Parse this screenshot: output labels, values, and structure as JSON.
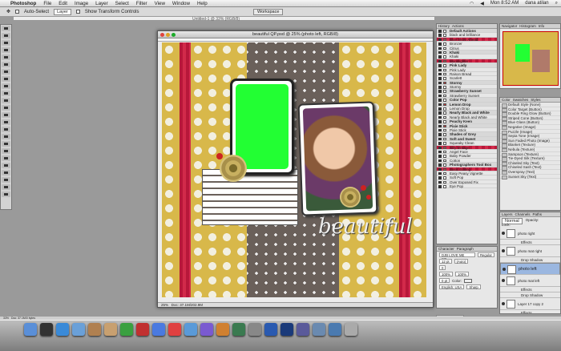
{
  "menubar": {
    "apple": "",
    "app_name": "Photoshop",
    "items": [
      "File",
      "Edit",
      "Image",
      "Layer",
      "Select",
      "Filter",
      "View",
      "Window",
      "Help"
    ],
    "clock": "Mon 8:52 AM",
    "user": "dana atilan"
  },
  "options": {
    "auto_select": "Auto-Select",
    "auto_select_value": "Layer",
    "show_transform": "Show Transform Controls",
    "workspace": "Workspace"
  },
  "background_doc": {
    "title": "Untitled-1 @ 33% (RGB/8)"
  },
  "document": {
    "title": "beautiful QP.psd @ 25% (photo left, RGB/8)",
    "zoom": "25%",
    "doc_size": "Doc: 37.1M/202.9M",
    "script_word": "beautiful"
  },
  "status": {
    "zoom": "33%",
    "doc_size": "Doc: 37.1M/0 bytes"
  },
  "navigator": {
    "tabs": [
      "Navigator",
      "Histogram",
      "Info"
    ]
  },
  "history_actions": {
    "tabs": [
      "History",
      "Actions"
    ],
    "rows": [
      {
        "label": "Default Actions",
        "type": "folder"
      },
      {
        "label": "black and brilliance",
        "type": "item"
      },
      {
        "label": "Blue Skies Ahead",
        "type": "item"
      },
      {
        "label": "Bronzer",
        "type": "item"
      },
      {
        "label": "Citrus",
        "type": "item"
      },
      {
        "label": "Khaki",
        "type": "folder"
      },
      {
        "label": "Khaki",
        "type": "item"
      },
      {
        "label": "Moonlighter",
        "type": "item"
      },
      {
        "label": "Pink Lady",
        "type": "folder"
      },
      {
        "label": "Pink Lady",
        "type": "item"
      },
      {
        "label": "Raison Bread",
        "type": "item"
      },
      {
        "label": "Scarlett",
        "type": "item"
      },
      {
        "label": "Stormy",
        "type": "folder"
      },
      {
        "label": "Stormy",
        "type": "item"
      },
      {
        "label": "Strawberry Sunset",
        "type": "folder"
      },
      {
        "label": "Strawberry Sunset",
        "type": "item"
      },
      {
        "label": "Color Pop",
        "type": "folder"
      },
      {
        "label": "Lemon Drop",
        "type": "folder"
      },
      {
        "label": "Lemon Drop",
        "type": "item"
      },
      {
        "label": "Nearly Black and White",
        "type": "folder"
      },
      {
        "label": "Nearly Black and White",
        "type": "item"
      },
      {
        "label": "Peachy Keen",
        "type": "folder"
      },
      {
        "label": "Pixie Stick",
        "type": "folder"
      },
      {
        "label": "Pixie Stick",
        "type": "item"
      },
      {
        "label": "Shades of Grey",
        "type": "folder"
      },
      {
        "label": "Soft and Sweet",
        "type": "folder"
      },
      {
        "label": "Squeaky Clean",
        "type": "item"
      },
      {
        "label": "Silly Vintage",
        "type": "item"
      },
      {
        "label": "Angel Face",
        "type": "item"
      },
      {
        "label": "Baby Powder",
        "type": "item"
      },
      {
        "label": "Cotton",
        "type": "item"
      },
      {
        "label": "Photographers Tool Box",
        "type": "folder"
      },
      {
        "label": "Basic Editing",
        "type": "item"
      },
      {
        "label": "Easy Peasy Vignette",
        "type": "item"
      },
      {
        "label": "Soft Pop",
        "type": "item"
      },
      {
        "label": "Over Exposed Fix",
        "type": "item"
      },
      {
        "label": "Eye Pop",
        "type": "item"
      }
    ]
  },
  "styles": {
    "tabs": [
      "Color",
      "Swatches",
      "Styles"
    ],
    "items": [
      "Default Style (None)",
      "Color Target (Button)",
      "Double Ring Glow (Button)",
      "Striped Cone (Button)",
      "Blue Glass (Button)",
      "Negative (Image)",
      "Puzzle (Image)",
      "Sepia Tone (Image)",
      "Sun Faded Photo (Image)",
      "Blanket (Texture)",
      "Nebula (Texture)",
      "Sampson (Texture)",
      "Tie-Dyed Silk (Texture)",
      "Chiseled Sky (Text)",
      "Chiseled Sash (Text)",
      "Overspray (Text)",
      "Sunset Sky (Text)"
    ]
  },
  "layers": {
    "tabs": [
      "Layers",
      "Channels",
      "Paths"
    ],
    "blend": "Normal",
    "opacity_label": "Opacity:",
    "lock_label": "Lock:",
    "rows": [
      {
        "label": "photo right",
        "type": "layer",
        "selected": false
      },
      {
        "label": "Effects",
        "type": "sub"
      },
      {
        "label": "photo mat right",
        "type": "layer",
        "selected": false
      },
      {
        "label": "Drop Shadow",
        "type": "sub"
      },
      {
        "label": "photo left",
        "type": "layer",
        "selected": true
      },
      {
        "label": "photo mat left",
        "type": "layer",
        "selected": false
      },
      {
        "label": "Effects",
        "type": "sub"
      },
      {
        "label": "Drop Shadow",
        "type": "sub"
      },
      {
        "label": "Layer 17 copy 2",
        "type": "layer",
        "selected": false
      },
      {
        "label": "Effects",
        "type": "sub"
      }
    ]
  },
  "character": {
    "tabs": [
      "Character",
      "Paragraph"
    ],
    "font": "DJB LOVE ME SO...",
    "style": "Regular",
    "size": "12 pt",
    "leading": "(Auto)",
    "kerning": "0",
    "scale_v": "100%",
    "scale_h": "100%",
    "baseline": "0 pt",
    "language": "English: USA",
    "aa": "Sharp",
    "color_label": "Color:"
  },
  "layer_comps": {
    "label": "Layer Comps"
  },
  "colors": {
    "accent_green": "#22ff33",
    "selection_blue": "#9bb7e0",
    "paper_red": "#b8173a",
    "paper_yellow": "#d8b84a"
  },
  "dock": {
    "icons": [
      "finder-icon",
      "dashboard-icon",
      "safari-icon",
      "mail-icon",
      "address-book-icon",
      "preview-icon",
      "ichat-icon",
      "photo-booth-icon",
      "itunes-icon",
      "ical-icon",
      "iphoto-icon",
      "imovie-icon",
      "garageband-icon",
      "time-machine-icon",
      "system-preferences-icon",
      "quicktime-icon",
      "photoshop-icon",
      "app-icon",
      "folder-icon",
      "downloads-icon",
      "trash-icon"
    ]
  }
}
